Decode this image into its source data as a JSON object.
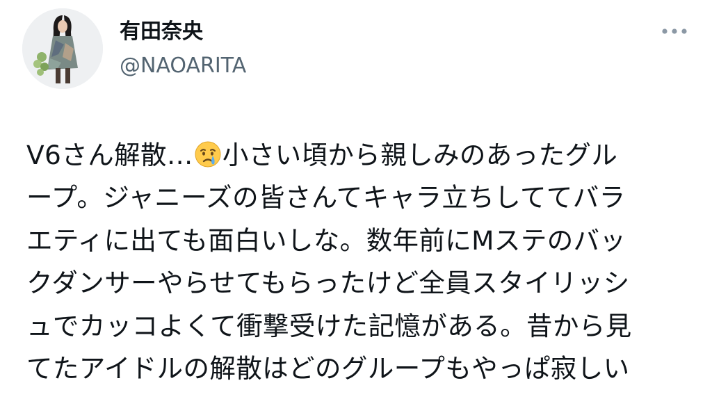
{
  "author": {
    "display_name": "有田奈央",
    "handle": "@NAOARITA"
  },
  "menu": {
    "icon": "more-horizontal-icon"
  },
  "tweet": {
    "line1_before_emoji": "V6さん解散…",
    "emoji": "crying-face-emoji",
    "line1_after_emoji": "小さい頃から親しみのあったグル",
    "line2": "ープ。ジャニーズの皆さんてキャラ立ちしててバラ",
    "line3": "エティに出ても面白いしな。数年前にMステのバッ",
    "line4": "クダンサーやらせてもらったけど全員スタイリッシ",
    "line5": "ュでカッコよくて衝撃受けた記憶がある。昔から見",
    "line6": "てたアイドルの解散はどのグループもやっぱ寂しい"
  }
}
